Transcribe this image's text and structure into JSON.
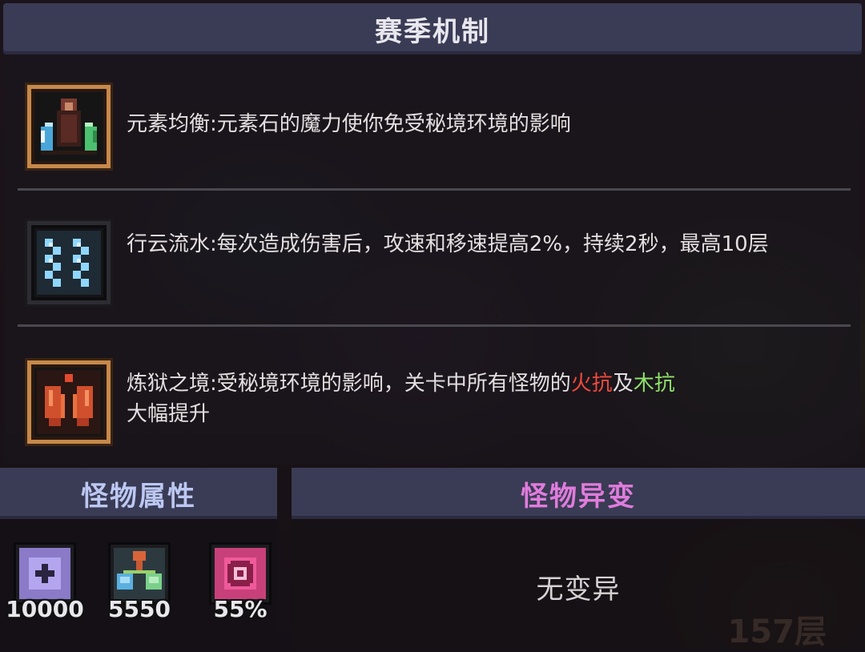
{
  "season": {
    "title": "赛季机制",
    "mechanics": [
      {
        "name": "元素均衡",
        "desc": "元素石的魔力使你免受秘境环境的影响",
        "icon": "element-stones-icon"
      },
      {
        "name": "行云流水",
        "desc": "每次造成伤害后，攻速和移速提高2%，持续2秒，最高10层",
        "icon": "flowing-water-icon"
      },
      {
        "name": "炼狱之境",
        "desc_before": "受秘境环境的影响，关卡中所有怪物的",
        "fire_res": "火抗",
        "conj": "及",
        "wood_res": "木抗",
        "desc_after": "大幅提升",
        "icon": "purgatory-heart-icon"
      }
    ]
  },
  "monster_attributes": {
    "title": "怪物属性",
    "stats": [
      {
        "icon": "health-shield-icon",
        "value": "10000"
      },
      {
        "icon": "attack-network-icon",
        "value": "5550"
      },
      {
        "icon": "crit-gear-icon",
        "value": "55%"
      }
    ]
  },
  "monster_mutation": {
    "title": "怪物异变",
    "value": "无变异",
    "watermark": "157层"
  },
  "colors": {
    "header_bg": "#3a3b55",
    "attr_title": "#bcc8f2",
    "mutation_title": "#e07cdc",
    "fire": "#f04a3e",
    "wood": "#8fe06a"
  }
}
